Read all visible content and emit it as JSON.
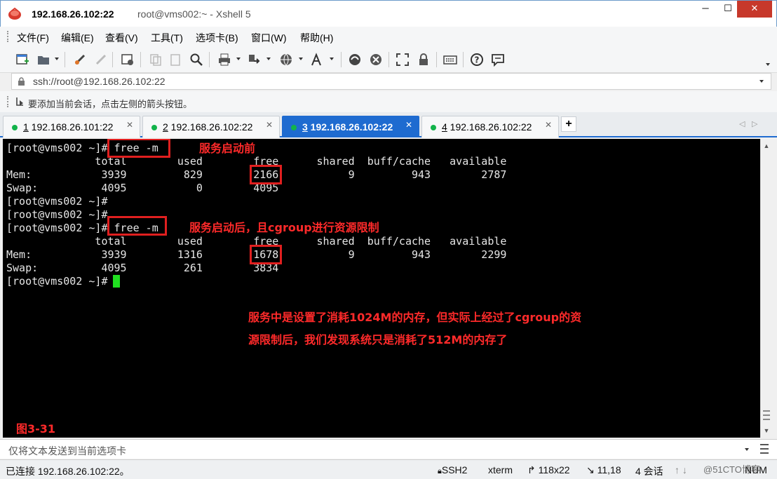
{
  "window": {
    "title_strong": "192.168.26.102:22",
    "title_rest": "root@vms002:~ - Xshell 5",
    "minimize": "─",
    "maximize": "☐",
    "close": "✕"
  },
  "menu": [
    "文件(F)",
    "编辑(E)",
    "查看(V)",
    "工具(T)",
    "选项卡(B)",
    "窗口(W)",
    "帮助(H)"
  ],
  "address": {
    "value": "ssh://root@192.168.26.102:22"
  },
  "hint": "要添加当前会话，点击左侧的箭头按钮。",
  "tabs": [
    {
      "num": "1",
      "host": " 192.168.26.101:22",
      "active": false
    },
    {
      "num": "2",
      "host": " 192.168.26.102:22",
      "active": false
    },
    {
      "num": "3",
      "host": " 192.168.26.102:22",
      "active": true
    },
    {
      "num": "4",
      "host": " 192.168.26.102:22",
      "active": false
    }
  ],
  "tab_close": "✕",
  "tab_new": "+",
  "tab_prev": "◁",
  "tab_next": "▷",
  "terminal": {
    "lines": [
      "[root@vms002 ~]# free -m",
      "              total        used        free      shared  buff/cache   available",
      "Mem:           3939         829        2166           9         943        2787",
      "Swap:          4095           0        4095",
      "[root@vms002 ~]#",
      "[root@vms002 ~]#",
      "[root@vms002 ~]# free -m",
      "              total        used        free      shared  buff/cache   available",
      "Mem:           3939        1316        1678           9         943        2299",
      "Swap:          4095         261        3834",
      "[root@vms002 ~]# "
    ]
  },
  "annotations": {
    "before": "服务启动前",
    "after": "服务启动后，且cgroup进行资源限制",
    "explain_1": "服务中是设置了消耗1024M的内存，但实际上经过了cgroup的资",
    "explain_2": "源限制后，我们发现系统只是消耗了512M的内存了",
    "figure": "图3-31"
  },
  "compose": {
    "placeholder": "仅将文本发送到当前选项卡"
  },
  "status": {
    "connection": "已连接 192.168.26.102:22。",
    "protocol": "SSH2",
    "term": "xterm",
    "size": "118x22",
    "cursor": "11,18",
    "sessions": "4 会话",
    "caps": "NUM"
  },
  "watermark": "@51CTO博客",
  "colors": {
    "annotation_red": "#ff2a2a",
    "active_tab": "#1e6bd0",
    "cursor_green": "#20e020",
    "session_dot": "#12b34a"
  }
}
